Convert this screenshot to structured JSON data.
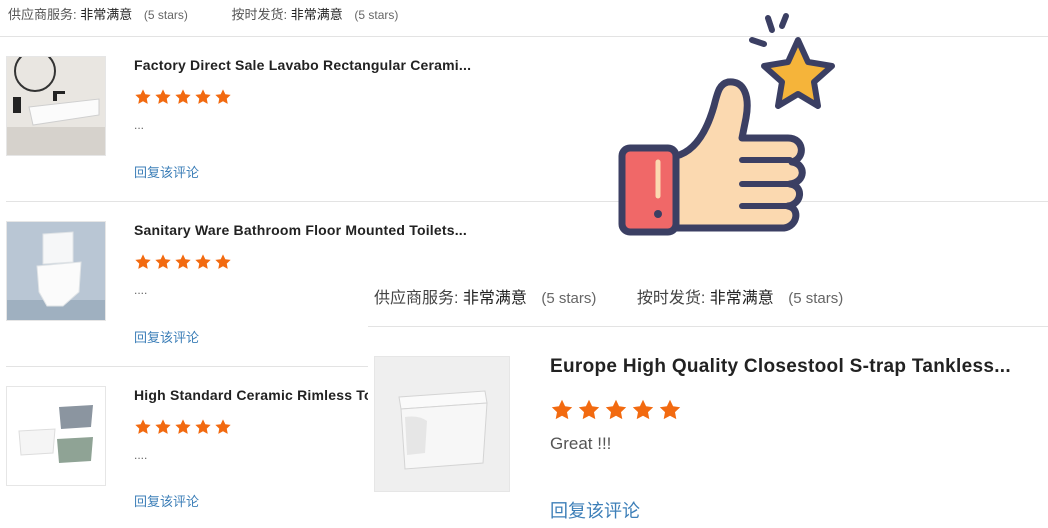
{
  "summary": {
    "service_label": "供应商服务:",
    "service_value": "非常满意",
    "service_stars": "(5 stars)",
    "shipping_label": "按时发货:",
    "shipping_value": "非常满意",
    "shipping_stars": "(5 stars)"
  },
  "reviews": [
    {
      "title": "Factory Direct Sale Lavabo Rectangular Cerami...",
      "rating": 5,
      "body": "...",
      "reply_label": "回复该评论"
    },
    {
      "title": "Sanitary Ware Bathroom Floor Mounted Toilets...",
      "rating": 5,
      "body": "....",
      "reply_label": "回复该评论"
    },
    {
      "title": "High Standard Ceramic Rimless To",
      "rating": 5,
      "body": "....",
      "reply_label": "回复该评论"
    }
  ],
  "zoomed": {
    "service_label": "供应商服务:",
    "service_value": "非常满意",
    "service_stars": "(5 stars)",
    "shipping_label": "按时发货:",
    "shipping_value": "非常满意",
    "shipping_stars": "(5 stars)",
    "title": "Europe High Quality Closestool S-trap Tankless...",
    "rating": 5,
    "body": "Great !!!",
    "reply_label": "回复该评论"
  },
  "colors": {
    "star": "#f26a10",
    "link": "#3d7fb8",
    "thumb_outline": "#3b3f63",
    "thumb_skin": "#fbd9b0",
    "thumb_cuff": "#f06868",
    "badge_star": "#f5b43a"
  },
  "icons": {
    "rating": "star-icon",
    "decor": "thumbs-up-icon"
  }
}
